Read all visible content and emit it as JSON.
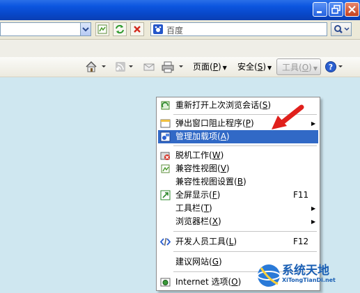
{
  "window": {
    "minimize_label": "minimize",
    "restore_label": "restore",
    "close_label": "close"
  },
  "searchbar": {
    "engine_text": "百度"
  },
  "commandbar": {
    "page_label": "页面",
    "page_key": "P",
    "safety_label": "安全",
    "safety_key": "S",
    "tools_label": "工具",
    "tools_key": "O"
  },
  "menu": {
    "items": [
      {
        "label": "重新打开上次浏览会话",
        "key": "S",
        "icon": "reopen-icon"
      },
      {
        "label": "弹出窗口阻止程序",
        "key": "P",
        "icon": "popup-blocker-icon",
        "submenu": true
      },
      {
        "label": "管理加载项",
        "key": "A",
        "icon": "addons-icon",
        "selected": true
      },
      {
        "label": "脱机工作",
        "key": "W",
        "icon": "offline-icon"
      },
      {
        "label": "兼容性视图",
        "key": "V",
        "icon": "compat-view-icon"
      },
      {
        "label": "兼容性视图设置",
        "key": "B"
      },
      {
        "label": "全屏显示",
        "key": "F",
        "shortcut": "F11",
        "icon": "fullscreen-icon"
      },
      {
        "label": "工具栏",
        "key": "T",
        "submenu": true
      },
      {
        "label": "浏览器栏",
        "key": "X",
        "submenu": true
      },
      {
        "label": "开发人员工具",
        "key": "L",
        "shortcut": "F12",
        "icon": "developer-tools-icon"
      },
      {
        "label": "建议网站",
        "key": "G"
      },
      {
        "label": "Internet 选项",
        "key": "O",
        "icon": "internet-options-icon"
      }
    ]
  },
  "watermark": {
    "title": "系统天地",
    "subtitle": "XiTongTianDi.net"
  },
  "colors": {
    "highlight": "#3169c6",
    "annotation_arrow": "#e0201c",
    "titlebar": "#0c56e0"
  }
}
